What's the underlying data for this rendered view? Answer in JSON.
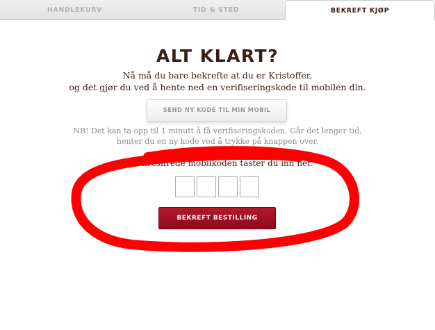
{
  "tabs": [
    {
      "label": "HANDLEKURV",
      "active": false
    },
    {
      "label": "TID & STED",
      "active": false
    },
    {
      "label": "BEKREFT KJØP",
      "active": true
    }
  ],
  "main": {
    "heading": "ALT KLART?",
    "intro_line1": "Nå må du bare bekrefte at du er Kristoffer,",
    "intro_line2": "og det gjør du ved å hente ned en verifiseringskode til mobilen din.",
    "send_code_button": "SEND NY KODE TIL MIN MOBIL",
    "note_line1": "NB! Det kan ta opp til 1 minutt å få verifiseringskoden. Går det lenger tid,",
    "note_line2": "henter du en ny kode ved å trykke på knappen over.",
    "code_label": "Den firesifrede mobilkoden taster du inn her.",
    "code_digits": [
      "",
      "",
      "",
      ""
    ],
    "confirm_button": "BEKREFT BESTILLING"
  },
  "colors": {
    "text_dark": "#3a1e14",
    "confirm_red": "#9e1021",
    "annotation_red": "#ff0000",
    "inactive_tab_text": "#b4b4b4"
  },
  "annotation": {
    "type": "hand-drawn ellipse",
    "color": "#ff0000"
  }
}
